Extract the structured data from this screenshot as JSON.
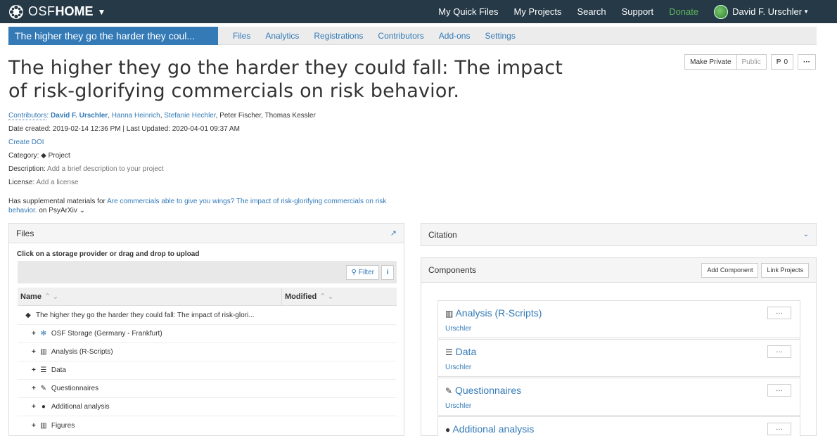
{
  "topnav": {
    "brand_osf": "OSF",
    "brand_home": "HOME",
    "links": [
      "My Quick Files",
      "My Projects",
      "Search",
      "Support"
    ],
    "donate": "Donate",
    "user_name": "David F. Urschler"
  },
  "projnav": {
    "title": "The higher they go the harder they coul...",
    "tabs": [
      "Files",
      "Analytics",
      "Registrations",
      "Contributors",
      "Add-ons",
      "Settings"
    ]
  },
  "project": {
    "title": "The higher they go the harder they could fall: The impact of risk-glorifying commercials on risk behavior.",
    "actions": {
      "make_private": "Make Private",
      "public": "Public",
      "forks": "0",
      "more": "···"
    },
    "contributors_label": "Contributors",
    "contributors": [
      "David F. Urschler",
      "Hanna Heinrich",
      "Stefanie Hechler",
      "Peter Fischer",
      "Thomas Kessler"
    ],
    "dates": "Date created: 2019-02-14 12:36 PM | Last Updated: 2020-04-01 09:37 AM",
    "create_doi": "Create DOI",
    "category_label": "Category:",
    "category_value": "Project",
    "description_label": "Description:",
    "description_value": "Add a brief description to your project",
    "license_label": "License:",
    "license_value": "Add a license",
    "supplemental_prefix": "Has supplemental materials for",
    "supplemental_link": "Are commercials able to give you wings? The impact of risk-glorifying commercials on risk behavior.",
    "supplemental_suffix": "on PsyArXiv"
  },
  "files": {
    "heading": "Files",
    "upload_hint": "Click on a storage provider or drag and drop to upload",
    "filter": "Filter",
    "col_name": "Name",
    "col_modified": "Modified",
    "root": "The higher they go the harder they could fall: The impact of risk-glori...",
    "rows": [
      {
        "icon": "osf-storage-icon",
        "label": "OSF Storage (Germany - Frankfurt)"
      },
      {
        "icon": "bar-chart-icon",
        "label": "Analysis (R-Scripts)"
      },
      {
        "icon": "database-icon",
        "label": "Data"
      },
      {
        "icon": "pencil-icon",
        "label": "Questionnaires"
      },
      {
        "icon": "comment-icon",
        "label": "Additional analysis"
      },
      {
        "icon": "bar-chart-icon",
        "label": "Figures"
      }
    ]
  },
  "citation": {
    "heading": "Citation"
  },
  "components": {
    "heading": "Components",
    "add_component": "Add Component",
    "link_projects": "Link Projects",
    "items": [
      {
        "icon": "bar-chart-icon",
        "name": "Analysis (R-Scripts)",
        "owner": "Urschler"
      },
      {
        "icon": "database-icon",
        "name": "Data",
        "owner": "Urschler"
      },
      {
        "icon": "pencil-icon",
        "name": "Questionnaires",
        "owner": "Urschler"
      },
      {
        "icon": "comment-icon",
        "name": "Additional analysis",
        "owner": ""
      }
    ],
    "more": "···"
  },
  "colors": {
    "navbar": "#263947",
    "accent": "#337ab7",
    "donate": "#5cb85c"
  }
}
